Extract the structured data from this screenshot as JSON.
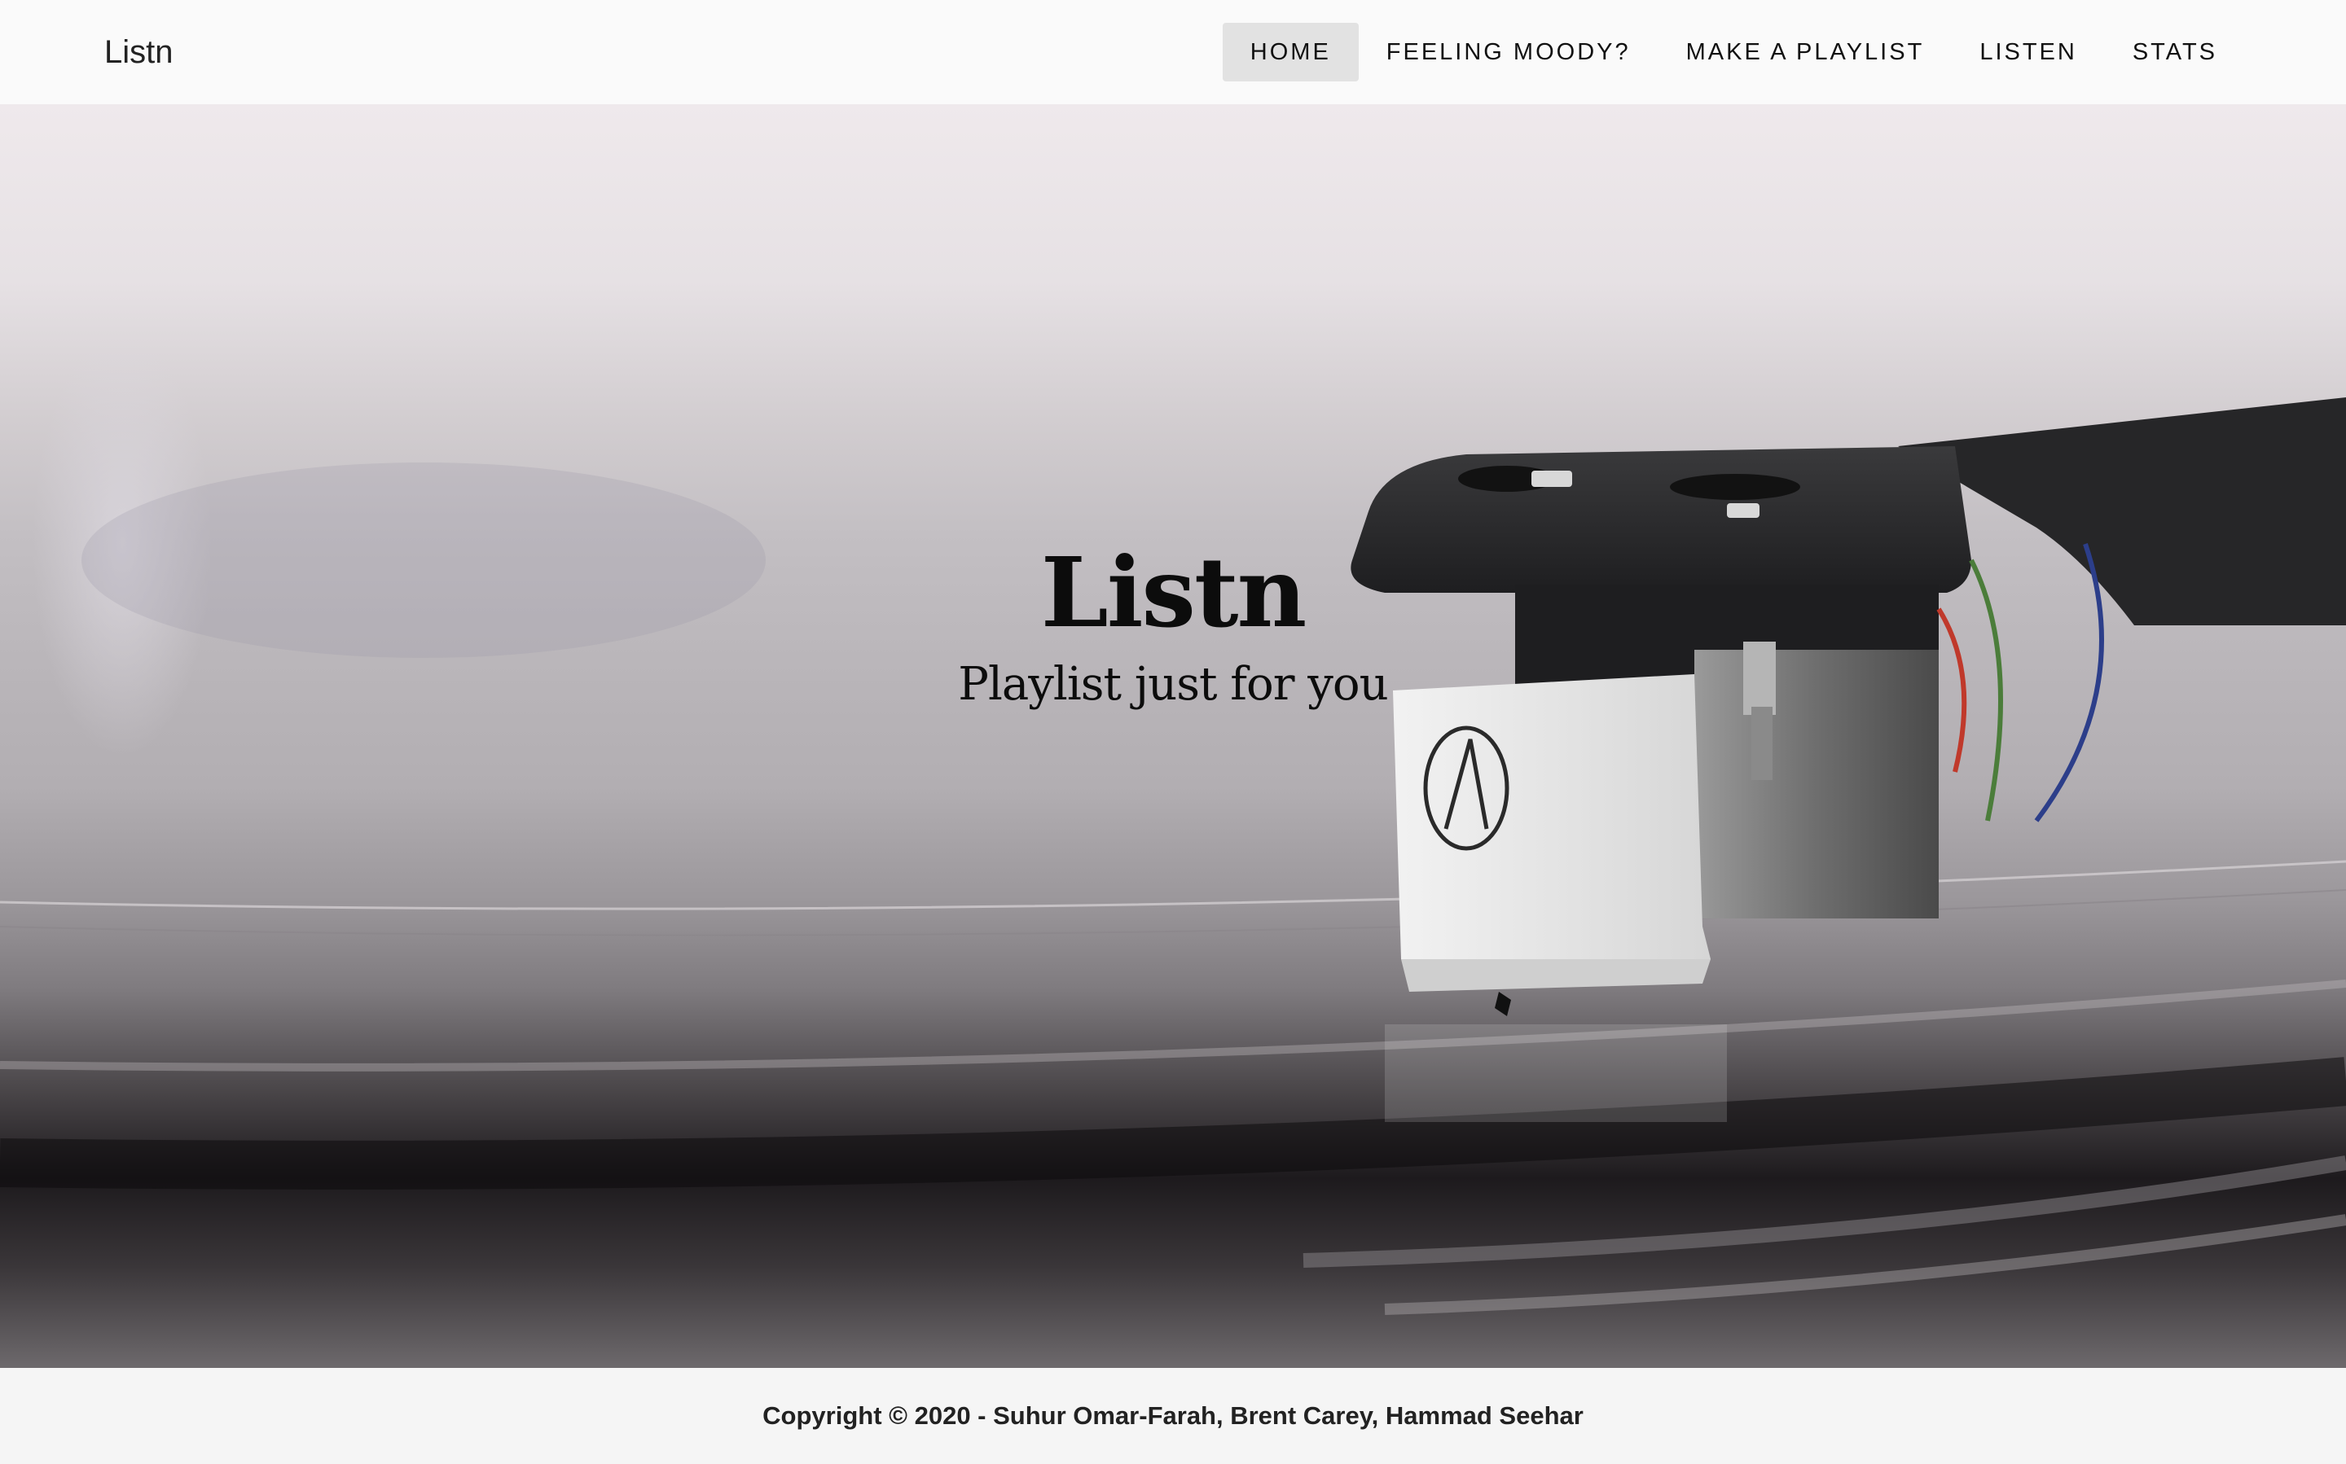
{
  "navbar": {
    "brand": "Listn",
    "items": [
      {
        "label": "HOME",
        "active": true
      },
      {
        "label": "FEELING MOODY?",
        "active": false
      },
      {
        "label": "MAKE A PLAYLIST",
        "active": false
      },
      {
        "label": "LISTEN",
        "active": false
      },
      {
        "label": "STATS",
        "active": false
      }
    ]
  },
  "hero": {
    "title": "Listn",
    "subtitle": "Playlist just for you"
  },
  "footer": {
    "copyright": "Copyright © 2020 - Suhur Omar-Farah, Brent Carey, Hammad Seehar"
  }
}
